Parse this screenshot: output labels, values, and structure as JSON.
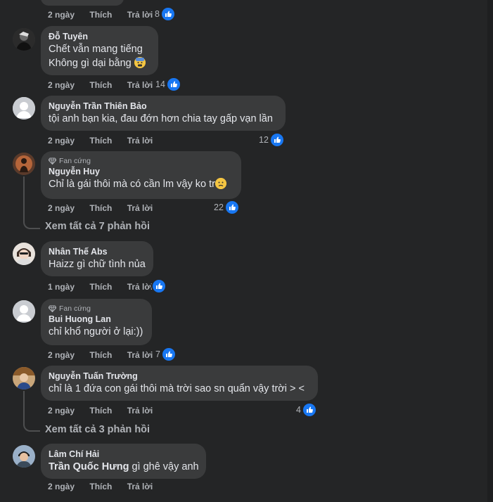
{
  "top_partial": {
    "time": "2 ngày",
    "like": "Thích",
    "reply": "Trả lời",
    "reactions": "8"
  },
  "comments": [
    {
      "author": "Đỗ Tuyên",
      "lines": [
        "Chết vẫn mang tiếng",
        "Không gì dại bằng"
      ],
      "time": "2 ngày",
      "like": "Thích",
      "reply": "Trả lời",
      "reactions": "14"
    },
    {
      "author": "Nguyễn Trần Thiên Bảo",
      "lines": [
        "tội anh bạn kia, đau đớn hơn chia tay gấp vạn lần"
      ],
      "time": "2 ngày",
      "like": "Thích",
      "reply": "Trả lời",
      "reactions": "12"
    },
    {
      "badge": "Fan cứng",
      "author": "Nguyễn Huy",
      "lines": [
        "Chỉ là gái thôi mà có cần lm vậy ko tr"
      ],
      "time": "2 ngày",
      "like": "Thích",
      "reply": "Trả lời",
      "reactions": "22",
      "view_replies": "Xem tất cả 7 phản hồi"
    },
    {
      "author": "Nhân Thế Abs",
      "lines": [
        "Haizz gì chữ tình nủa"
      ],
      "time": "1 ngày",
      "like": "Thích",
      "reply": "Trả lời",
      "reactions": ""
    },
    {
      "badge": "Fan cứng",
      "author": "Bui Huong Lan",
      "lines": [
        "chỉ khổ người ở lại:))"
      ],
      "time": "2 ngày",
      "like": "Thích",
      "reply": "Trả lời",
      "reactions": "7"
    },
    {
      "author": "Nguyễn Tuấn Trường",
      "lines": [
        "chỉ là 1 đứa con gái thôi mà trời sao sn quẩn vậy trời > <"
      ],
      "time": "2 ngày",
      "like": "Thích",
      "reply": "Trả lời",
      "reactions": "4",
      "view_replies": "Xem tất cả 3 phản hồi"
    },
    {
      "author": "Lâm Chí Hải",
      "mention": "Trần Quốc Hưng",
      "lines": [
        " gì ghê vậy anh"
      ],
      "time": "2 ngày",
      "like": "Thích",
      "reply": "Trả lời"
    }
  ],
  "colors": {
    "background": "#242526",
    "bubble": "#3a3b3c",
    "like_blue": "#1877f2",
    "muted": "#b0b3b8"
  },
  "icons": {
    "like": "thumbs-up-icon",
    "badge": "diamond-icon",
    "avatar_default": "default-avatar-icon"
  }
}
